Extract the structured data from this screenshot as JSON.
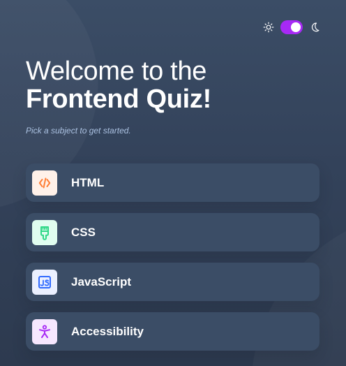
{
  "header": {
    "theme_toggle": {
      "light_icon": "sun-icon",
      "dark_icon": "moon-icon",
      "state": "dark",
      "accent": "#a729f5"
    }
  },
  "hero": {
    "title_line_1": "Welcome to the",
    "title_line_2": "Frontend Quiz!",
    "subtitle": "Pick a subject to get started."
  },
  "subjects": [
    {
      "label": "HTML",
      "icon": "html-icon",
      "icon_bg": "#fff1e9",
      "icon_color": "#ff7e35"
    },
    {
      "label": "CSS",
      "icon": "css-icon",
      "icon_bg": "#e0fdef",
      "icon_color": "#2fd887"
    },
    {
      "label": "JavaScript",
      "icon": "javascript-icon",
      "icon_bg": "#ebf0ff",
      "icon_color": "#306aff"
    },
    {
      "label": "Accessibility",
      "icon": "accessibility-icon",
      "icon_bg": "#f6e7ff",
      "icon_color": "#a729f5"
    }
  ],
  "colors": {
    "background": "#313e51",
    "card": "#3b4d66",
    "subtitle": "#abc1e1",
    "text": "#ffffff"
  }
}
